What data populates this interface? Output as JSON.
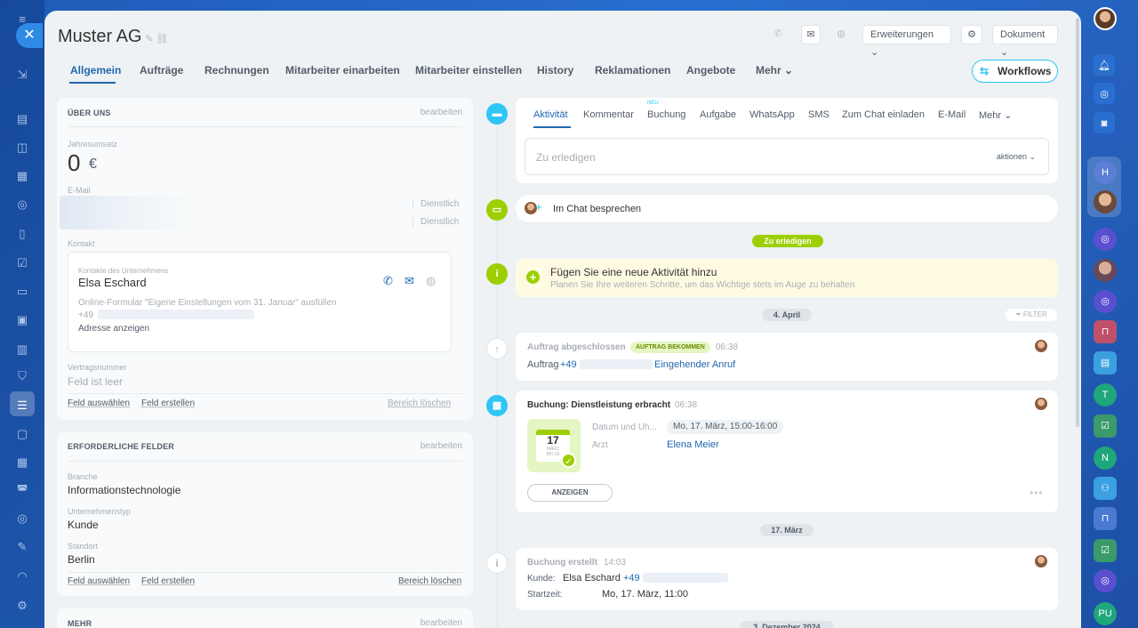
{
  "header": {
    "title": "Muster AG",
    "ext_label": "Erweiterungen",
    "doc_label": "Dokument"
  },
  "tabs": [
    "Allgemein",
    "Aufträge",
    "Rechnungen",
    "Mitarbeiter einarbeiten",
    "Mitarbeiter einstellen",
    "History",
    "Reklamationen",
    "Angebote",
    "Mehr"
  ],
  "workflows_label": "Workflows",
  "about": {
    "heading": "ÜBER UNS",
    "edit": "bearbeiten",
    "revenue_label": "Jahresumsatz",
    "revenue_value": "0",
    "currency": "€",
    "email_label": "E-Mail",
    "email_type1": "Dienstlich",
    "email_type2": "Dienstlich",
    "contact_label": "Kontakt",
    "contact_sub": "Kontakte des Unternehmens",
    "contact_name": "Elsa Eschard",
    "form_text": "Online-Formular \"Eigene Einstellungen vom 31. Januar\" ausfüllen",
    "phone_prefix": "+49",
    "address_link": "Adresse anzeigen",
    "contract_label": "Vertragsnummer",
    "contract_value": "Feld ist leer",
    "select_field": "Feld auswählen",
    "create_field": "Feld erstellen",
    "delete_area": "Bereich löschen"
  },
  "required": {
    "heading": "ERFORDERLICHE FELDER",
    "edit": "bearbeiten",
    "industry_label": "Branche",
    "industry_value": "Informationstechnologie",
    "type_label": "Unternehmenstyp",
    "type_value": "Kunde",
    "location_label": "Standort",
    "location_value": "Berlin",
    "select_field": "Feld auswählen",
    "create_field": "Feld erstellen",
    "delete_area": "Bereich löschen"
  },
  "more": {
    "heading": "MEHR",
    "edit": "bearbeiten"
  },
  "activity_tabs": {
    "items": [
      "Aktivität",
      "Kommentar",
      "Buchung",
      "Aufgabe",
      "WhatsApp",
      "SMS",
      "Zum Chat einladen",
      "E-Mail",
      "Mehr"
    ],
    "new_badge": "NEU"
  },
  "todo_input": {
    "placeholder": "Zu erledigen",
    "actions": "aktionen"
  },
  "chat": {
    "label": "Im Chat besprechen"
  },
  "todo_pill": "Zu erledigen",
  "add_activity": {
    "title": "Fügen Sie eine neue Aktivität hinzu",
    "subtitle": "Planen Sie Ihre weiteren Schritte, um das Wichtige stets im Auge zu behalten"
  },
  "date1": "4. April",
  "filter": "FILTER",
  "event1": {
    "title": "Auftrag abgeschlossen",
    "badge": "AUFTRAG BEKOMMEN",
    "time": "06:38",
    "line_prefix": "Auftrag",
    "phone": "+49",
    "link": "Eingehender Anruf"
  },
  "event2": {
    "title": "Buchung: Dienstleistung erbracht",
    "time": "06:38",
    "date_label": "Datum und Uh...",
    "date_value": "Mo, 17. März, 15:00-16:00",
    "doctor_label": "Arzt",
    "doctor_value": "Elena Meier",
    "show_btn": "ANZEIGEN",
    "cal_day": "17",
    "cal_month": "MÄRZ",
    "cal_weekday": "MO.16"
  },
  "date2": "17. März",
  "event3": {
    "title": "Buchung erstellt",
    "time": "14:03",
    "client_label": "Kunde:",
    "client_value": "Elsa Eschard",
    "client_phone": "+49",
    "start_label": "Startzeit:",
    "start_value": "Mo, 17. März, 11:00"
  },
  "date3": "3. Dezember 2024",
  "rail": {
    "h": "H",
    "t": "T",
    "n": "N",
    "pu": "PU"
  }
}
